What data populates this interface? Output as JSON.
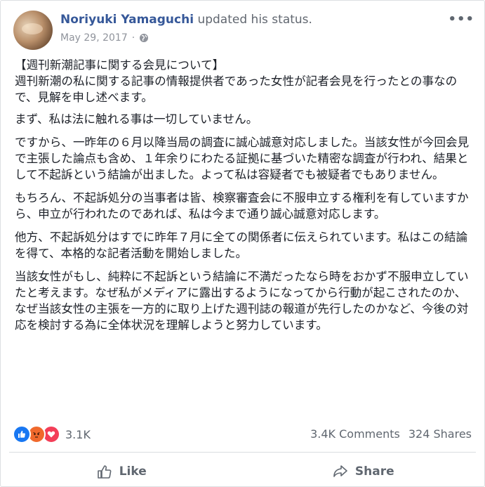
{
  "post": {
    "author": "Noriyuki Yamaguchi",
    "action_text": "updated his status.",
    "date": "May 29, 2017",
    "more_icon": "more-options-icon",
    "audience_icon": "globe-icon"
  },
  "body": {
    "title": "【週刊新潮記事に関する会見について】",
    "paragraphs": [
      "週刊新潮の私に関する記事の情報提供者であった女性が記者会見を行ったとの事なので、見解を申し述べます。",
      "まず、私は法に触れる事は一切していません。",
      "ですから、一昨年の６月以降当局の調査に誠心誠意対応しました。当該女性が今回会見で主張した論点も含め、１年余りにわたる証拠に基づいた精密な調査が行われ、結果として不起訴という結論が出ました。よって私は容疑者でも被疑者でもありません。",
      "もちろん、不起訴処分の当事者は皆、検察審査会に不服申立する権利を有していますから、申立が行われたのであれば、私は今まで通り誠心誠意対応します。",
      "他方、不起訴処分はすでに昨年７月に全ての関係者に伝えられています。私はこの結論を得て、本格的な記者活動を開始しました。",
      "当該女性がもし、純粋に不起訴という結論に不満だったなら時をおかず不服申立していたと考えます。なぜ私がメディアに露出するようになってから行動が起こされたのか、なぜ当該女性の主張を一方的に取り上げた週刊誌の報道が先行したのかなど、今後の対応を検討する為に全体状況を理解しようと努力しています。"
    ]
  },
  "stats": {
    "reactions_count": "3.1K",
    "comments": "3.4K Comments",
    "shares": "324 Shares",
    "reaction_icons": [
      "like-reaction-icon",
      "angry-reaction-icon",
      "love-reaction-icon"
    ],
    "colors": {
      "like": "#1877f2",
      "angry": "#f0692c",
      "love": "#f33e58"
    }
  },
  "actions": {
    "like_label": "Like",
    "share_label": "Share"
  }
}
